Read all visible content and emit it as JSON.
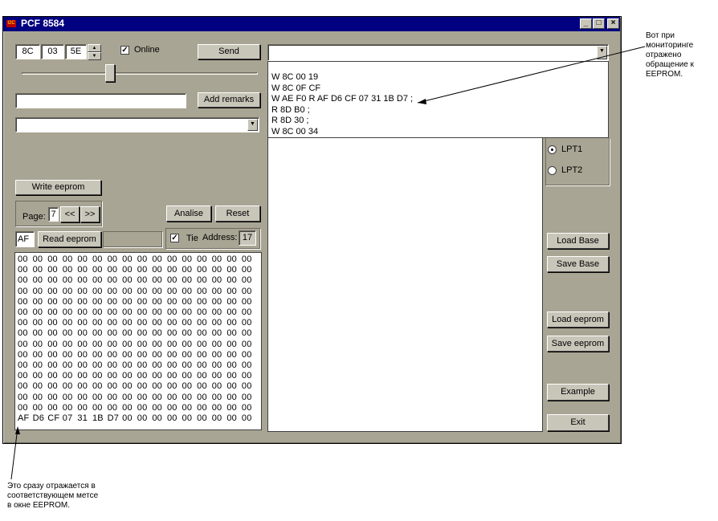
{
  "window": {
    "title": "PCF 8584",
    "icon": "i2c-app-icon",
    "buttons": [
      "_",
      "□",
      "×"
    ]
  },
  "top": {
    "addr_fields": [
      "8C",
      "03",
      "5E"
    ],
    "online_label": "Online",
    "online_checked": true,
    "send_label": "Send",
    "slider_level": 0.37,
    "remarks_value": "",
    "add_remarks_label": "Add remarks",
    "combo_value": "",
    "main_combo_value": ""
  },
  "monitor": {
    "lines": [
      "W 8C 00 19",
      "W 8C 0F CF",
      "W AE F0  R AF D6 CF 07 31 1B D7  ;",
      "R 8D B0  ;",
      "R 8D 30  ;",
      "W 8C 00 34"
    ]
  },
  "eeprom": {
    "write_label": "Write eeprom",
    "page_label": "Page:",
    "page_value": "7",
    "prev_label": "<<",
    "next_label": ">>",
    "analise_label": "Analise",
    "reset_label": "Reset",
    "addr_box": "AF",
    "read_label": "Read eeprom",
    "tie_label": "Tie",
    "tie_checked": true,
    "address_label": "Address:",
    "address_value": "17",
    "rows": [
      [
        "00",
        "00",
        "00",
        "00",
        "00",
        "00",
        "00",
        "00",
        "00",
        "00",
        "00",
        "00",
        "00",
        "00",
        "00",
        "00"
      ],
      [
        "00",
        "00",
        "00",
        "00",
        "00",
        "00",
        "00",
        "00",
        "00",
        "00",
        "00",
        "00",
        "00",
        "00",
        "00",
        "00"
      ],
      [
        "00",
        "00",
        "00",
        "00",
        "00",
        "00",
        "00",
        "00",
        "00",
        "00",
        "00",
        "00",
        "00",
        "00",
        "00",
        "00"
      ],
      [
        "00",
        "00",
        "00",
        "00",
        "00",
        "00",
        "00",
        "00",
        "00",
        "00",
        "00",
        "00",
        "00",
        "00",
        "00",
        "00"
      ],
      [
        "00",
        "00",
        "00",
        "00",
        "00",
        "00",
        "00",
        "00",
        "00",
        "00",
        "00",
        "00",
        "00",
        "00",
        "00",
        "00"
      ],
      [
        "00",
        "00",
        "00",
        "00",
        "00",
        "00",
        "00",
        "00",
        "00",
        "00",
        "00",
        "00",
        "00",
        "00",
        "00",
        "00"
      ],
      [
        "00",
        "00",
        "00",
        "00",
        "00",
        "00",
        "00",
        "00",
        "00",
        "00",
        "00",
        "00",
        "00",
        "00",
        "00",
        "00"
      ],
      [
        "00",
        "00",
        "00",
        "00",
        "00",
        "00",
        "00",
        "00",
        "00",
        "00",
        "00",
        "00",
        "00",
        "00",
        "00",
        "00"
      ],
      [
        "00",
        "00",
        "00",
        "00",
        "00",
        "00",
        "00",
        "00",
        "00",
        "00",
        "00",
        "00",
        "00",
        "00",
        "00",
        "00"
      ],
      [
        "00",
        "00",
        "00",
        "00",
        "00",
        "00",
        "00",
        "00",
        "00",
        "00",
        "00",
        "00",
        "00",
        "00",
        "00",
        "00"
      ],
      [
        "00",
        "00",
        "00",
        "00",
        "00",
        "00",
        "00",
        "00",
        "00",
        "00",
        "00",
        "00",
        "00",
        "00",
        "00",
        "00"
      ],
      [
        "00",
        "00",
        "00",
        "00",
        "00",
        "00",
        "00",
        "00",
        "00",
        "00",
        "00",
        "00",
        "00",
        "00",
        "00",
        "00"
      ],
      [
        "00",
        "00",
        "00",
        "00",
        "00",
        "00",
        "00",
        "00",
        "00",
        "00",
        "00",
        "00",
        "00",
        "00",
        "00",
        "00"
      ],
      [
        "00",
        "00",
        "00",
        "00",
        "00",
        "00",
        "00",
        "00",
        "00",
        "00",
        "00",
        "00",
        "00",
        "00",
        "00",
        "00"
      ],
      [
        "00",
        "00",
        "00",
        "00",
        "00",
        "00",
        "00",
        "00",
        "00",
        "00",
        "00",
        "00",
        "00",
        "00",
        "00",
        "00"
      ],
      [
        "AF",
        "D6",
        "CF",
        "07",
        "31",
        "1B",
        "D7",
        "00",
        "00",
        "00",
        "00",
        "00",
        "00",
        "00",
        "00",
        "00"
      ]
    ]
  },
  "right": {
    "lpt1_label": "LPT1",
    "lpt2_label": "LPT2",
    "lpt_selected": "LPT1",
    "load_base": "Load Base",
    "save_base": "Save Base",
    "load_eeprom": "Load eeprom",
    "save_eeprom": "Save eeprom",
    "example": "Example",
    "exit": "Exit"
  },
  "annotations": {
    "top_right": [
      "Вот при",
      "мониторинге",
      "отражено",
      "обращение  к",
      "EEPROM."
    ],
    "bottom_left": [
      "Это сразу отражается в",
      "соответствующем метсе",
      "в окне EEPROM."
    ]
  },
  "colors": {
    "title_bar": "#000080",
    "face": "#a9a594",
    "button": "#c8c5b9"
  }
}
